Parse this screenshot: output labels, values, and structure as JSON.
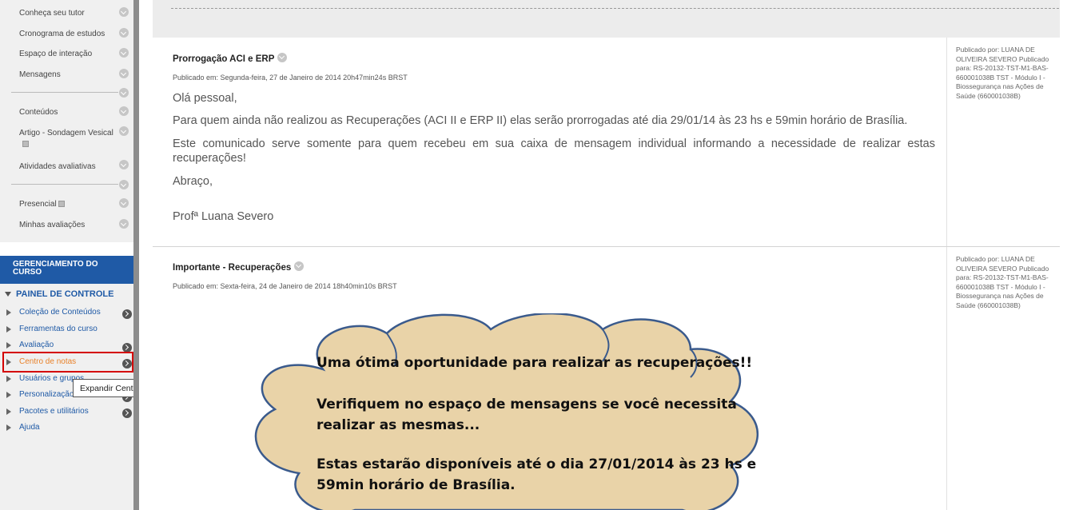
{
  "sidebar": {
    "menu_items": [
      {
        "label": "Conheça seu tutor"
      },
      {
        "label": "Cronograma de estudos"
      },
      {
        "label": "Espaço de interação"
      },
      {
        "label": "Mensagens"
      },
      {
        "label": "Conteúdos"
      },
      {
        "label": "Artigo - Sondagem Vesical"
      },
      {
        "label": "Atividades avaliativas"
      },
      {
        "label": "Presencial"
      },
      {
        "label": "Minhas avaliações"
      }
    ],
    "manage_header": "GERENCIAMENTO DO CURSO",
    "control_panel": {
      "title": "PAINEL DE CONTROLE",
      "items": [
        {
          "label": "Coleção de Conteúdos"
        },
        {
          "label": "Ferramentas do curso"
        },
        {
          "label": "Avaliação"
        },
        {
          "label": "Centro de notas"
        },
        {
          "label": "Usuários e grupos"
        },
        {
          "label": "Personalização"
        },
        {
          "label": "Pacotes e utilitários"
        },
        {
          "label": "Ajuda"
        }
      ]
    },
    "tooltip": "Expandir Centro de notas",
    "highlight_color": "#d40000",
    "highlighted_item_color": "#e8822a"
  },
  "posts": [
    {
      "title": "Prorrogação ACI e ERP",
      "date": "Publicado em: Segunda-feira, 27 de Janeiro de 2014 20h47min24s BRST",
      "body": [
        "Olá pessoal,",
        "Para quem ainda não realizou as Recuperações (ACI II e ERP II) elas serão prorrogadas até dia 29/01/14 às 23 hs e 59min horário de Brasília.",
        "Este comunicado serve somente para quem recebeu em sua caixa de mensagem individual informando a necessidade de realizar estas recuperações!",
        "Abraço,",
        "Profª Luana Severo"
      ],
      "meta": "Publicado por: LUANA DE OLIVEIRA SEVERO Publicado para: RS-20132-TST-M1-BAS-660001038B TST - Módulo I - Biossegurança nas Ações de Saúde (660001038B)"
    },
    {
      "title": "Importante - Recuperações",
      "date": "Publicado em: Sexta-feira, 24 de Janeiro de 2014 18h40min10s BRST",
      "image_text": [
        "Uma ótima oportunidade para realizar as recuperações!!",
        "Verifiquem no espaço de mensagens se você necessita",
        "realizar as mesmas...",
        "Estas estarão disponíveis até o dia 27/01/2014 às 23 hs e",
        "59min horário de Brasília."
      ],
      "meta": "Publicado por: LUANA DE OLIVEIRA SEVERO Publicado para: RS-20132-TST-M1-BAS-660001038B TST - Módulo I - Biossegurança nas Ações de Saúde (660001038B)"
    }
  ],
  "colors": {
    "brand_blue": "#1f5aa6",
    "cloud_fill": "#e9d3a8",
    "cloud_stroke": "#3a5a8c"
  }
}
